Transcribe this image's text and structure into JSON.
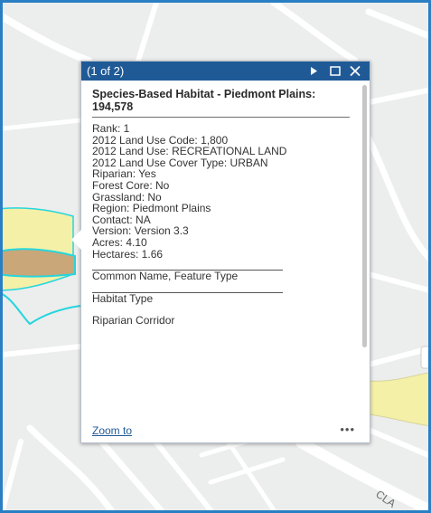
{
  "popup": {
    "count": "(1 of 2)",
    "title": "Species-Based Habitat - Piedmont Plains: 194,578",
    "attributes": [
      "Rank: 1",
      "2012 Land Use Code: 1,800",
      "2012 Land Use: RECREATIONAL LAND",
      "2012 Land Use Cover Type: URBAN",
      "Riparian: Yes",
      "Forest Core: No",
      "Grassland: No",
      "Region: Piedmont Plains",
      "Contact: NA",
      "Version: Version 3.3",
      "Acres: 4.10",
      "Hectares: 1.66"
    ],
    "section1": "Common Name, Feature Type",
    "section2": "Habitat Type",
    "section3": "Riparian Corridor",
    "zoom_label": "Zoom to",
    "more_label": "•••",
    "icons": {
      "next": "next-arrow-icon",
      "maximize": "maximize-icon",
      "close": "close-icon"
    }
  },
  "map": {
    "street_label": "CLA",
    "colors": {
      "background": "#eceded",
      "road": "#ffffff",
      "habitat_fill": "#f4f0a8",
      "selected_fill": "#c9a779",
      "selected_outline": "#25d6dd",
      "header": "#1f5a96",
      "border": "#2a7fc4"
    }
  }
}
